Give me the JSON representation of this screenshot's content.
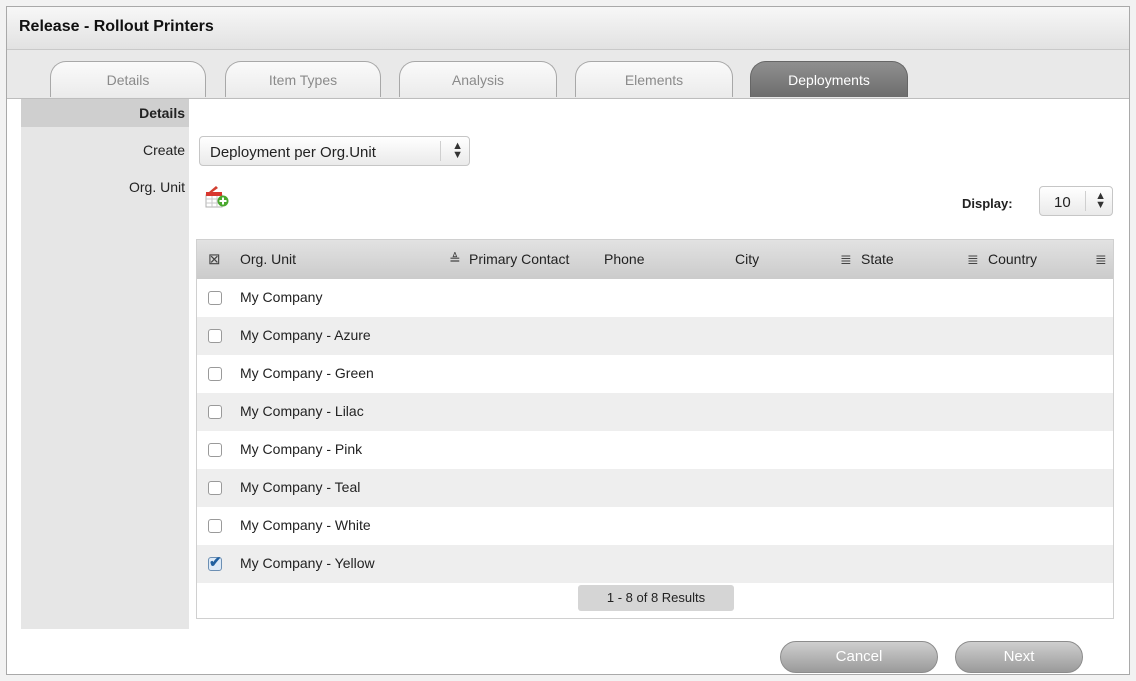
{
  "window": {
    "title": "Release - Rollout Printers"
  },
  "tabs": [
    {
      "label": "Details",
      "active": false
    },
    {
      "label": "Item Types",
      "active": false
    },
    {
      "label": "Analysis",
      "active": false
    },
    {
      "label": "Elements",
      "active": false
    },
    {
      "label": "Deployments",
      "active": true
    }
  ],
  "form": {
    "section_label": "Details",
    "create_label": "Create",
    "create_value": "Deployment per Org.Unit",
    "org_unit_label": "Org. Unit",
    "add_icon": "add-org-unit-icon"
  },
  "display": {
    "label": "Display:",
    "value": "10"
  },
  "table": {
    "columns": {
      "org_unit": "Org. Unit",
      "primary_contact": "Primary Contact",
      "phone": "Phone",
      "city": "City",
      "state": "State",
      "country": "Country"
    },
    "rows": [
      {
        "org_unit": "My Company",
        "checked": false
      },
      {
        "org_unit": "My Company - Azure",
        "checked": false
      },
      {
        "org_unit": "My Company - Green",
        "checked": false
      },
      {
        "org_unit": "My Company - Lilac",
        "checked": false
      },
      {
        "org_unit": "My Company - Pink",
        "checked": false
      },
      {
        "org_unit": "My Company - Teal",
        "checked": false
      },
      {
        "org_unit": "My Company - White",
        "checked": false
      },
      {
        "org_unit": "My Company - Yellow",
        "checked": true
      }
    ],
    "pager": "1 - 8 of 8 Results"
  },
  "buttons": {
    "cancel": "Cancel",
    "next": "Next"
  },
  "colors": {
    "active_tab": "#7a7a7a",
    "checkbox_tick": "#1f5fa0"
  }
}
